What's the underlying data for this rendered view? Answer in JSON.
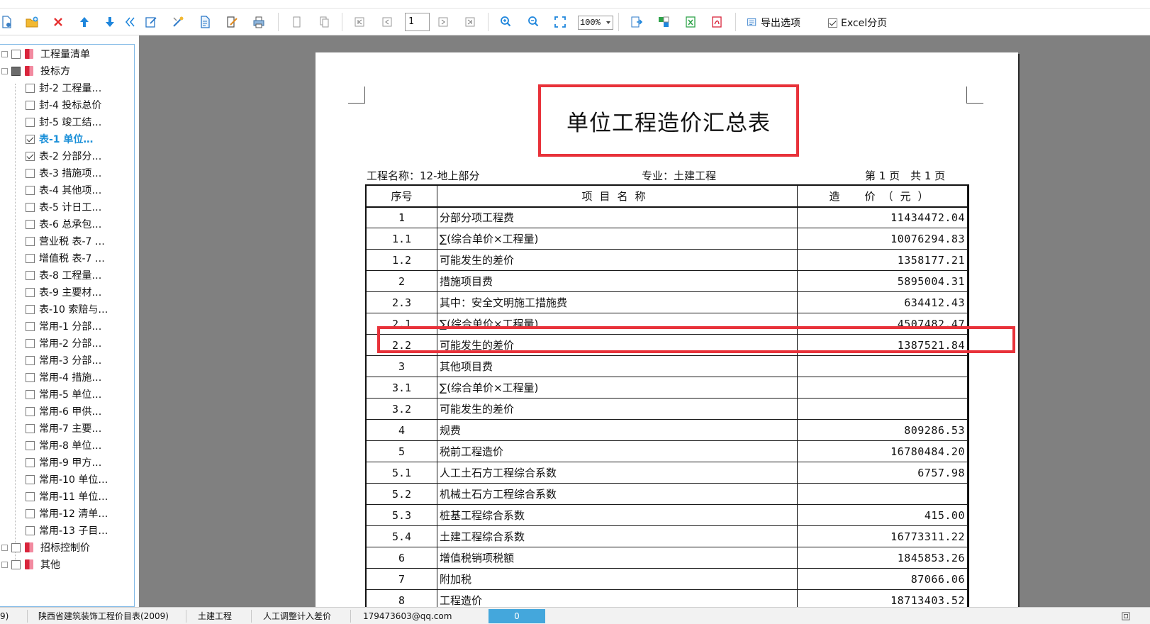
{
  "toolbar": {
    "page_number": "1",
    "zoom": "100%",
    "export_options_label": "导出选项",
    "excel_split_label": "Excel分页",
    "excel_split_checked": true
  },
  "tree": {
    "items": [
      {
        "label": "工程量清单"
      },
      {
        "label": "投标方"
      },
      {
        "label": "封-2 工程量…"
      },
      {
        "label": "封-4 投标总价"
      },
      {
        "label": "封-5 竣工结…"
      },
      {
        "label": "表-1 单位…"
      },
      {
        "label": "表-2 分部分…"
      },
      {
        "label": "表-3 措施项…"
      },
      {
        "label": "表-4 其他项…"
      },
      {
        "label": "表-5 计日工…"
      },
      {
        "label": "表-6 总承包…"
      },
      {
        "label": "营业税 表-7 …"
      },
      {
        "label": "增值税 表-7 …"
      },
      {
        "label": "表-8 工程量…"
      },
      {
        "label": "表-9 主要材…"
      },
      {
        "label": "表-10 索赔与…"
      },
      {
        "label": "常用-1 分部…"
      },
      {
        "label": "常用-2 分部…"
      },
      {
        "label": "常用-3 分部…"
      },
      {
        "label": "常用-4 措施…"
      },
      {
        "label": "常用-5 单位…"
      },
      {
        "label": "常用-6 甲供…"
      },
      {
        "label": "常用-7 主要…"
      },
      {
        "label": "常用-8 单位…"
      },
      {
        "label": "常用-9 甲方…"
      },
      {
        "label": "常用-10 单位…"
      },
      {
        "label": "常用-11 单位…"
      },
      {
        "label": "常用-12 清单…"
      },
      {
        "label": "常用-13 子目…"
      },
      {
        "label": "招标控制价"
      },
      {
        "label": "其他"
      }
    ]
  },
  "report": {
    "title": "单位工程造价汇总表",
    "project_name": "工程名称：12-地上部分",
    "specialty": "专业：土建工程",
    "page_info": "第 1 页　共 1 页",
    "headers": [
      "序号",
      "项目名称",
      "造　价（元）"
    ],
    "rows": [
      {
        "no": "1",
        "name": "分部分项工程费",
        "amount": "11434472.04"
      },
      {
        "no": "1.1",
        "name": "∑(综合单价×工程量)",
        "amount": "10076294.83"
      },
      {
        "no": "1.2",
        "name": "可能发生的差价",
        "amount": "1358177.21"
      },
      {
        "no": "2",
        "name": "措施项目费",
        "amount": "5895004.31"
      },
      {
        "no": "2.3",
        "name": "其中：安全文明施工措施费",
        "amount": "634412.43"
      },
      {
        "no": "2.1",
        "name": "∑(综合单价×工程量)",
        "amount": "4507482.47"
      },
      {
        "no": "2.2",
        "name": "可能发生的差价",
        "amount": "1387521.84"
      },
      {
        "no": "3",
        "name": "其他项目费",
        "amount": ""
      },
      {
        "no": "3.1",
        "name": "∑(综合单价×工程量)",
        "amount": ""
      },
      {
        "no": "3.2",
        "name": "可能发生的差价",
        "amount": ""
      },
      {
        "no": "4",
        "name": "规费",
        "amount": "809286.53"
      },
      {
        "no": "5",
        "name": "税前工程造价",
        "amount": "16780484.20"
      },
      {
        "no": "5.1",
        "name": "人工土石方工程综合系数",
        "amount": "6757.98"
      },
      {
        "no": "5.2",
        "name": "机械土石方工程综合系数",
        "amount": ""
      },
      {
        "no": "5.3",
        "name": "桩基工程综合系数",
        "amount": "415.00"
      },
      {
        "no": "5.4",
        "name": "土建工程综合系数",
        "amount": "16773311.22"
      },
      {
        "no": "6",
        "name": "增值税销项税额",
        "amount": "1845853.26"
      },
      {
        "no": "7",
        "name": "附加税",
        "amount": "87066.06"
      },
      {
        "no": "8",
        "name": "工程造价",
        "amount": "18713403.52"
      }
    ]
  },
  "status": {
    "left_fragment": "9)",
    "quota": "陕西省建筑装饰工程价目表(2009)",
    "specialty": "土建工程",
    "adjust": "人工调整计入差价",
    "account": "179473603@qq.com",
    "progress": "0"
  },
  "colors": {
    "highlight_red": "#e8323a",
    "selected_blue": "#1a8fd8",
    "tree_border": "#7fb8e6",
    "progress_blue": "#44a7dc"
  }
}
